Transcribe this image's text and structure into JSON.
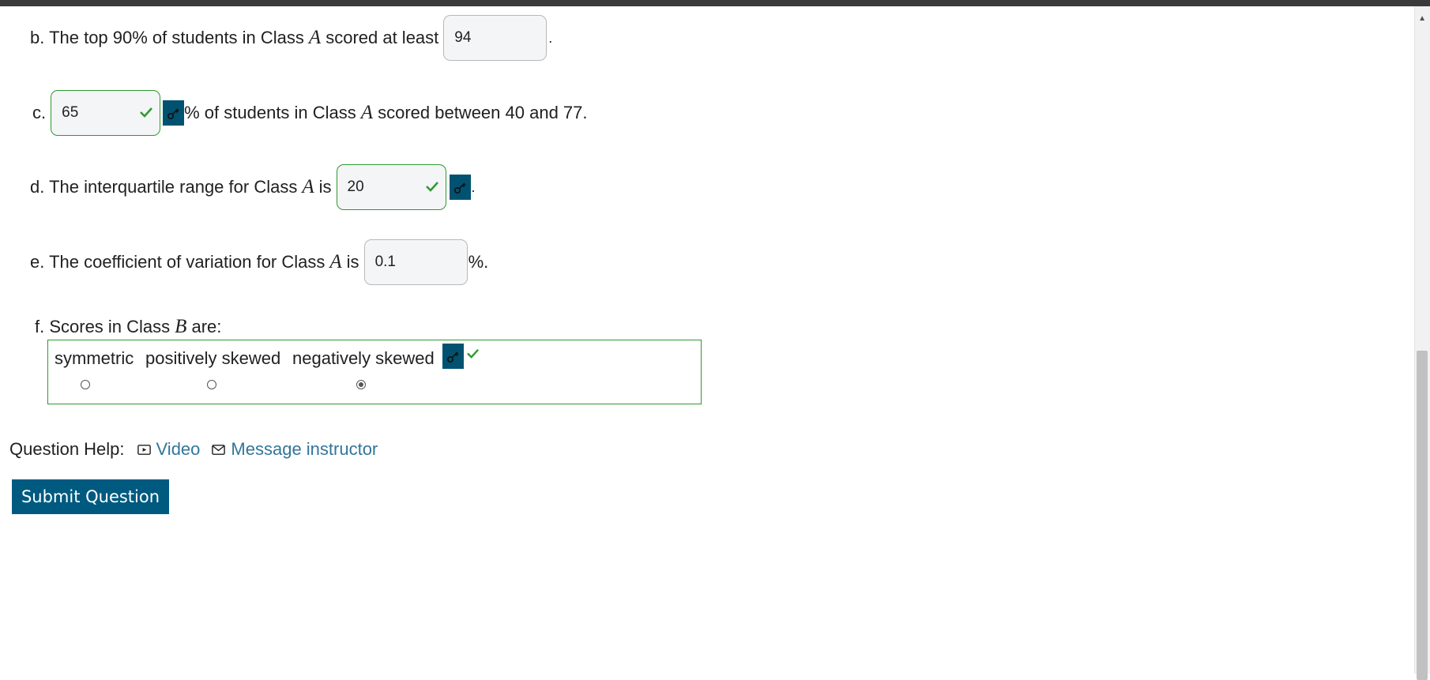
{
  "question": {
    "b": {
      "prefix": "b. The top 90% of students in Class",
      "var": "A",
      "middle": "scored at least",
      "answer": "94",
      "suffix": "."
    },
    "c": {
      "prefix": "c.",
      "answer": "65",
      "suffix": "% of students in Class",
      "var": "A",
      "tail": "scored between 40 and 77."
    },
    "d": {
      "prefix": "d. The interquartile range for Class",
      "var": "A",
      "middle": "is",
      "answer": "20",
      "suffix": "."
    },
    "e": {
      "prefix": "e. The coefficient of variation for Class",
      "var": "A",
      "middle": "is",
      "answer": "0.1",
      "suffix": "%."
    },
    "f": {
      "prefix": "f. Scores in Class",
      "var": "B",
      "suffix": "are:",
      "options": [
        "symmetric",
        "positively skewed",
        "negatively skewed"
      ],
      "selected": "negatively skewed"
    }
  },
  "help": {
    "label": "Question Help:",
    "video": "Video",
    "message": "Message instructor"
  },
  "submit_label": "Submit Question",
  "colors": {
    "accent": "#005a80",
    "correct": "#2e9a2e",
    "link": "#31769a"
  },
  "icons": [
    "key-icon",
    "checkmark-icon",
    "video-icon",
    "envelope-icon",
    "scroll-up-arrow-icon"
  ]
}
